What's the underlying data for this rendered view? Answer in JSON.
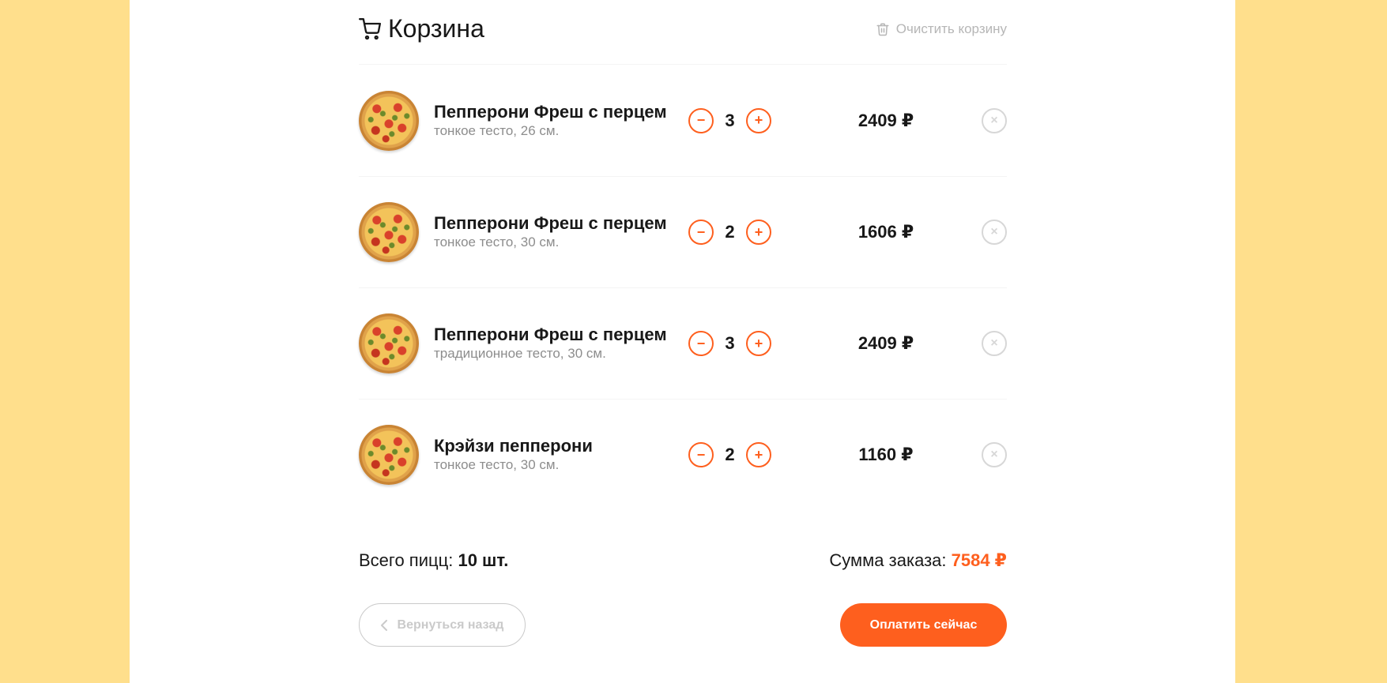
{
  "cart": {
    "title": "Корзина",
    "clear_label": "Очистить корзину",
    "icons": {
      "title": "cart-icon",
      "clear": "trash-icon"
    },
    "items": [
      {
        "name": "Пепперони Фреш с перцем",
        "desc": "тонкое тесто, 26 см.",
        "qty": "3",
        "price": "2409 ₽"
      },
      {
        "name": "Пепперони Фреш с перцем",
        "desc": "тонкое тесто, 30 см.",
        "qty": "2",
        "price": "1606 ₽"
      },
      {
        "name": "Пепперони Фреш с перцем",
        "desc": "традиционное тесто, 30 см.",
        "qty": "3",
        "price": "2409 ₽"
      },
      {
        "name": "Крэйзи пепперони",
        "desc": "тонкое тесто, 30 см.",
        "qty": "2",
        "price": "1160 ₽"
      }
    ],
    "minus": "−",
    "plus": "+",
    "remove": "×"
  },
  "summary": {
    "total_label": "Всего пицц:",
    "total_value": "10 шт.",
    "sum_label": "Сумма заказа:",
    "sum_value": "7584 ₽"
  },
  "actions": {
    "back_label": "Вернуться назад",
    "pay_label": "Оплатить сейчас"
  },
  "colors": {
    "accent": "#fe5f1e",
    "background": "#ffdf8c",
    "muted": "#b6b6b6"
  }
}
